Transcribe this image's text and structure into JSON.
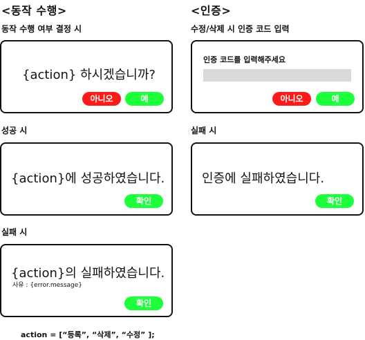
{
  "sections": {
    "action": {
      "title": "<동작 수행>",
      "confirm": {
        "label": "동작 수행 여부 결정 시",
        "message": "{action} 하시겠습니까?",
        "no_button": "아니오",
        "yes_button": "예"
      },
      "success": {
        "label": "성공 시",
        "message": "{action}에 성공하였습니다.",
        "ok_button": "확인"
      },
      "failure": {
        "label": "실패 시",
        "message": "{action}의 실패하였습니다.",
        "reason": "사유 : {error.message}",
        "ok_button": "확인"
      },
      "note": "action = [“등록”, “삭제”, “수정” ];"
    },
    "auth": {
      "title": "<인증>",
      "prompt": {
        "label": "수정/삭제 시 인증 코드 입력",
        "message": "인증 코드를 입력해주세요",
        "input_value": "",
        "no_button": "아니오",
        "yes_button": "예"
      },
      "failure": {
        "label": "실패 시",
        "message": "인증에 실패하였습니다.",
        "ok_button": "확인"
      }
    }
  },
  "colors": {
    "cancel": "#ff1a1a",
    "confirm": "#1cff3a",
    "input": "#d9d9d9",
    "border": "#111111"
  }
}
